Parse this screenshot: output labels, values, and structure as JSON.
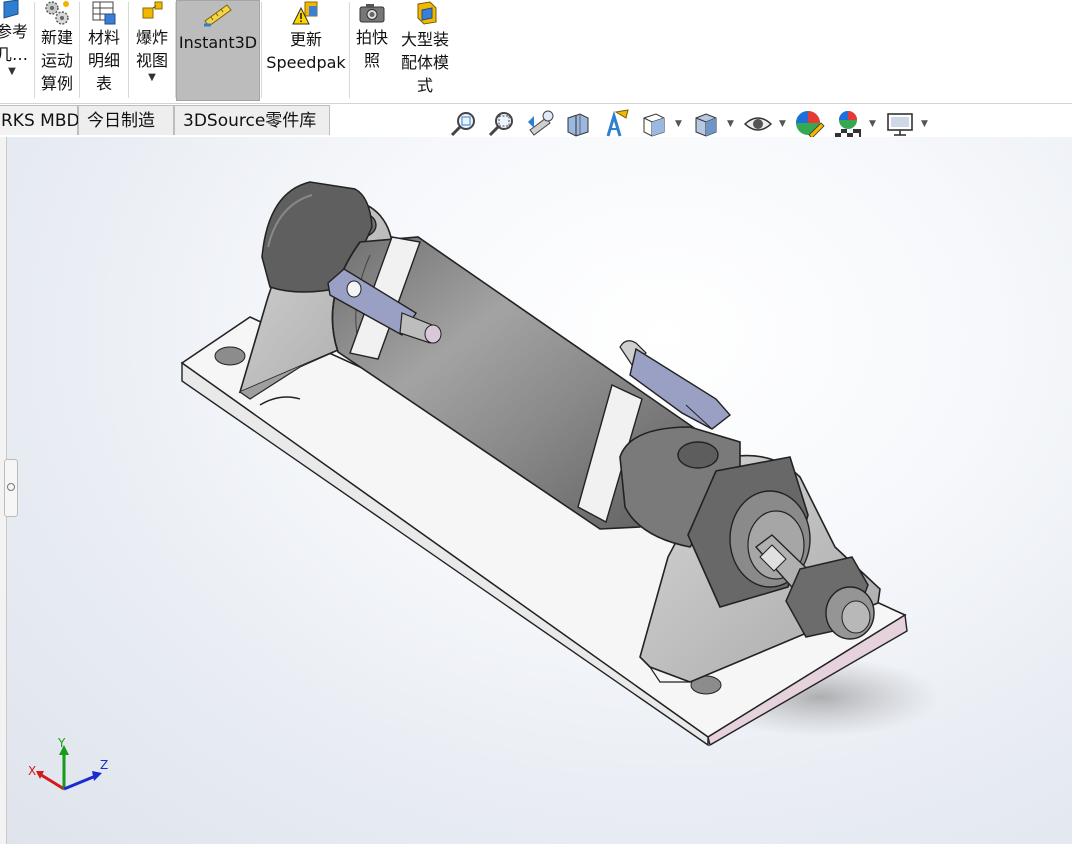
{
  "ribbon": {
    "items": [
      {
        "label": "参考\n几…",
        "has_dropdown": true
      },
      {
        "label": "新建\n运动\n算例",
        "has_dropdown": false
      },
      {
        "label": "材料\n明细\n表",
        "has_dropdown": false
      },
      {
        "label": "爆炸\n视图",
        "has_dropdown": true
      },
      {
        "label": "Instant3D",
        "active": true
      },
      {
        "label": "更新\nSpeedpak"
      },
      {
        "label": "拍快\n照"
      },
      {
        "label": "大型装\n配体模\n式"
      }
    ]
  },
  "tabs": [
    {
      "label": "RKS MBD"
    },
    {
      "label": "今日制造"
    },
    {
      "label": "3DSource零件库"
    }
  ],
  "heads_up_toolbar": {
    "icons": [
      "zoom-to-fit-icon",
      "zoom-to-area-icon",
      "previous-view-icon",
      "section-view-icon",
      "dynamic-annotation-view-icon",
      "view-orientation-icon",
      "display-style-icon",
      "hide-show-items-icon",
      "edit-appearance-icon",
      "apply-scene-icon",
      "view-settings-icon"
    ]
  },
  "triad": {
    "x_label": "X",
    "y_label": "Y",
    "z_label": "Z"
  },
  "colors": {
    "ribbon_active": "#bcbcbc",
    "cylinder_body": "#8a8a8a",
    "bracket": "#bdbdbd",
    "plate_side": "#e6d2dc",
    "sensor": "#9a9fc4",
    "axis_x": "#d11a1a",
    "axis_y": "#1a9a1a",
    "axis_z": "#1a2cd1"
  }
}
